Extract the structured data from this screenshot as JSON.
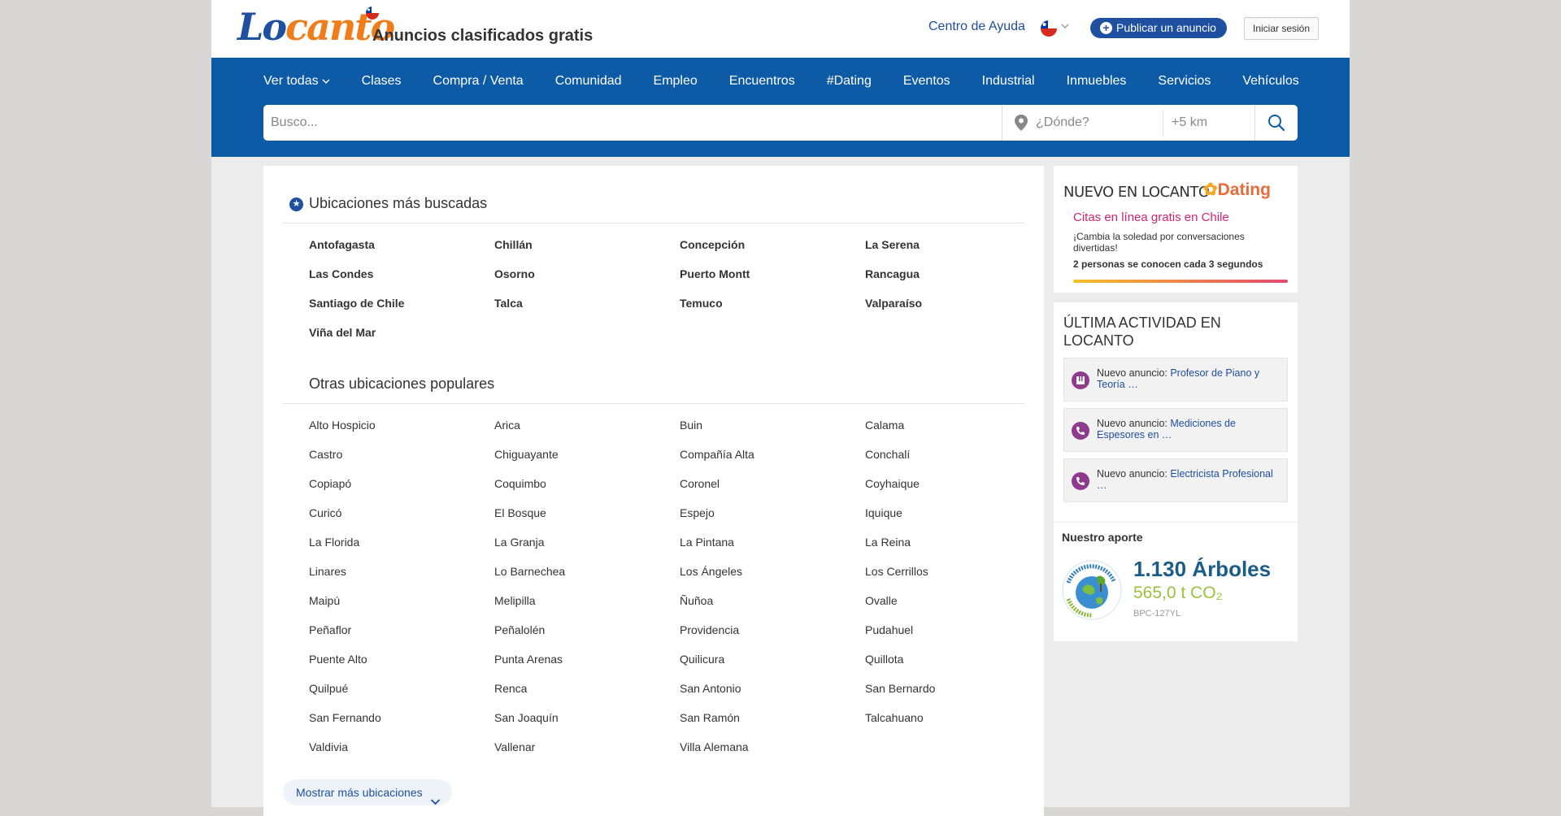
{
  "header": {
    "logo": "Locanto",
    "tagline": "Anuncios clasificados gratis",
    "help_link": "Centro de Ayuda",
    "publish_button": "Publicar un anuncio",
    "login_button": "Iniciar sesión"
  },
  "nav": {
    "items": [
      "Ver todas",
      "Clases",
      "Compra / Venta",
      "Comunidad",
      "Empleo",
      "Encuentros",
      "#Dating",
      "Eventos",
      "Industrial",
      "Inmuebles",
      "Servicios",
      "Vehículos"
    ]
  },
  "search": {
    "query_placeholder": "Busco...",
    "where_placeholder": "¿Dónde?",
    "radius_placeholder": "+5 km"
  },
  "main": {
    "top_title": "Ubicaciones más buscadas",
    "top_locations": [
      "Antofagasta",
      "Chillán",
      "Concepción",
      "La Serena",
      "Las Condes",
      "Osorno",
      "Puerto Montt",
      "Rancagua",
      "Santiago de Chile",
      "Talca",
      "Temuco",
      "Valparaíso",
      "Viña del Mar"
    ],
    "other_title": "Otras ubicaciones populares",
    "other_locations": [
      "Alto Hospicio",
      "Arica",
      "Buin",
      "Calama",
      "Castro",
      "Chiguayante",
      "Compañía Alta",
      "Conchalí",
      "Copiapó",
      "Coquimbo",
      "Coronel",
      "Coyhaique",
      "Curicó",
      "El Bosque",
      "Espejo",
      "Iquique",
      "La Florida",
      "La Granja",
      "La Pintana",
      "La Reina",
      "Linares",
      "Lo Barnechea",
      "Los Ángeles",
      "Los Cerrillos",
      "Maipú",
      "Melipilla",
      "Ñuñoa",
      "Ovalle",
      "Peñaflor",
      "Peñalolén",
      "Providencia",
      "Pudahuel",
      "Puente Alto",
      "Punta Arenas",
      "Quilicura",
      "Quillota",
      "Quilpué",
      "Renca",
      "San Antonio",
      "San Bernardo",
      "San Fernando",
      "San Joaquín",
      "San Ramón",
      "Talcahuano",
      "Valdivia",
      "Vallenar",
      "Villa Alemana"
    ],
    "more_button": "Mostrar más ubicaciones"
  },
  "sidebar": {
    "dating": {
      "heading": "NUEVO EN LOCANTO",
      "logo": "Dating",
      "subtitle": "Citas en línea gratis en Chile",
      "description": "¡Cambia la soledad por conversaciones divertidas!",
      "stat": "2 personas se conocen cada 3 segundos"
    },
    "activity": {
      "title": "ÚLTIMA ACTIVIDAD EN LOCANTO",
      "items": [
        {
          "prefix": "Nuevo anuncio: ",
          "link": "Profesor de Piano y Teoría …"
        },
        {
          "prefix": "Nuevo anuncio: ",
          "link": "Mediciones de Espesores en …"
        },
        {
          "prefix": "Nuevo anuncio: ",
          "link": "Electricista Profesional …"
        }
      ]
    },
    "aporte": {
      "title": "Nuestro aporte",
      "trees": "1.130 Árboles",
      "co2": "565,0 t CO₂",
      "code": "BPC-127YL"
    }
  },
  "colors": {
    "brand_blue": "#0d5ba6",
    "link_blue": "#1f4fa0",
    "logo_orange": "#f07d1a",
    "dating_pink": "#d4236e"
  }
}
